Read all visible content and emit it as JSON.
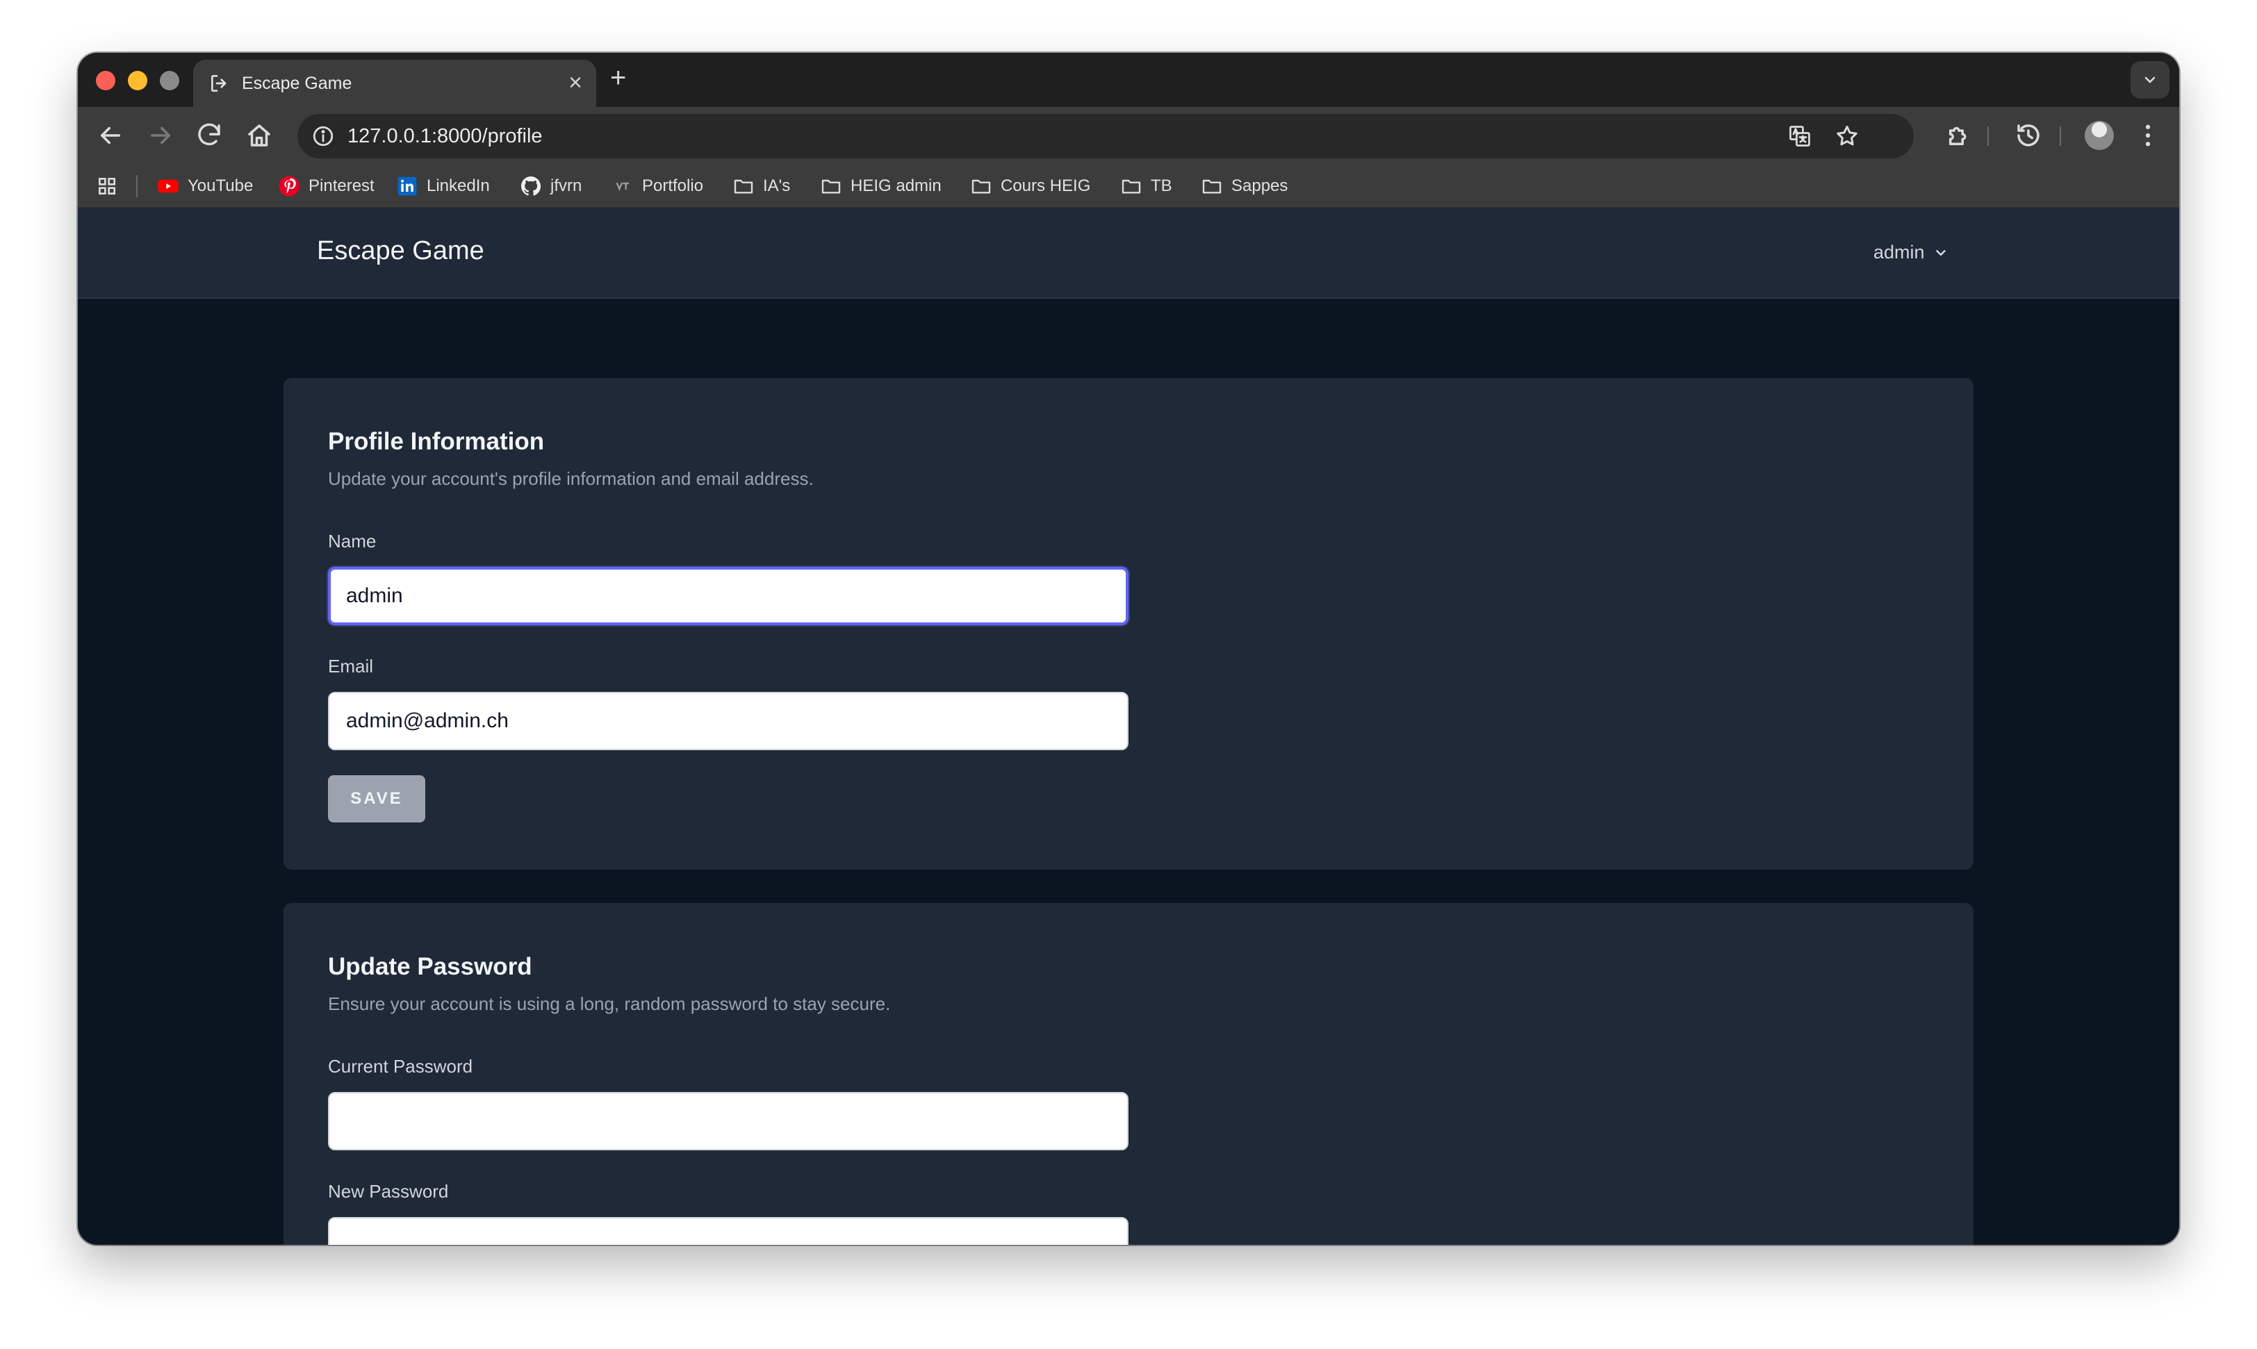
{
  "browser": {
    "tab": {
      "title": "Escape Game",
      "close_glyph": "×",
      "icon": "sign-in-icon"
    },
    "new_tab_glyph": "+",
    "url": "127.0.0.1:8000/profile",
    "bookmarks": [
      {
        "label": "YouTube",
        "icon": "youtube-icon"
      },
      {
        "label": "Pinterest",
        "icon": "pinterest-icon"
      },
      {
        "label": "LinkedIn",
        "icon": "linkedin-icon"
      },
      {
        "label": "jfvrn",
        "icon": "github-icon"
      },
      {
        "label": "Portfolio",
        "icon": "portfolio-icon"
      },
      {
        "label": "IA's",
        "icon": "folder-icon"
      },
      {
        "label": "HEIG admin",
        "icon": "folder-icon"
      },
      {
        "label": "Cours HEIG",
        "icon": "folder-icon"
      },
      {
        "label": "TB",
        "icon": "folder-icon"
      },
      {
        "label": "Sappes",
        "icon": "folder-icon"
      }
    ]
  },
  "app": {
    "brand": "Escape Game",
    "user_menu_label": "admin"
  },
  "profile": {
    "title": "Profile Information",
    "description": "Update your account's profile information and email address.",
    "name_label": "Name",
    "name_value": "admin",
    "email_label": "Email",
    "email_value": "admin@admin.ch",
    "save_label": "SAVE"
  },
  "password": {
    "title": "Update Password",
    "description": "Ensure your account is using a long, random password to stay secure.",
    "current_label": "Current Password",
    "current_value": "",
    "new_label": "New Password",
    "new_value": ""
  },
  "colors": {
    "page_bg": "#0b1522",
    "card_bg": "#1f2937",
    "focus_ring": "#6366f1",
    "save_button": "#9ca3af"
  }
}
